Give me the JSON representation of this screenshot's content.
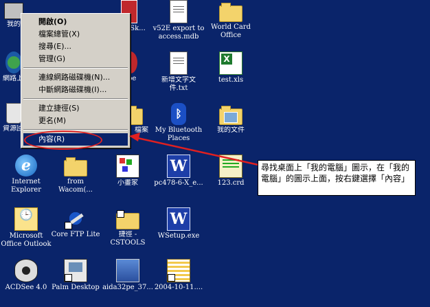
{
  "desktop_icons": [
    {
      "key": "mycomp",
      "label": "我的",
      "icon": "computer-icon"
    },
    {
      "key": "net",
      "label": "網路上",
      "icon": "network-icon"
    },
    {
      "key": "recycle",
      "label": "資源回",
      "icon": "recycle-bin-icon"
    },
    {
      "key": "ie",
      "label": "Internet\nExplorer",
      "icon": "internet-explorer-icon"
    },
    {
      "key": "outlook",
      "label": "Microsoft\nOffice Outlook",
      "icon": "outlook-icon"
    },
    {
      "key": "acdsee",
      "label": "ACDSee 4.0",
      "icon": "acdsee-icon"
    },
    {
      "key": "wacom",
      "label": "from\nWacom(...",
      "icon": "folder-icon"
    },
    {
      "key": "ftp",
      "label": "Core FTP Lite",
      "icon": "ftp-icon"
    },
    {
      "key": "palm",
      "label": "Palm Desktop",
      "icon": "palm-icon"
    },
    {
      "key": "sk",
      "label": "e-Sk...",
      "icon": "app-icon"
    },
    {
      "key": "pe",
      "label": "pe",
      "icon": "app-icon"
    },
    {
      "key": "docfolder",
      "label": "檔案",
      "icon": "folder-icon"
    },
    {
      "key": "paint",
      "label": "小畫家",
      "icon": "paint-icon"
    },
    {
      "key": "cstools",
      "label": "捷徑 -\nCSTOOLS",
      "icon": "shortcut-folder-icon"
    },
    {
      "key": "aida",
      "label": "aida32pe_37...",
      "icon": "aida-icon"
    },
    {
      "key": "v52e",
      "label": "v52E export to\naccess.mdb",
      "icon": "database-icon"
    },
    {
      "key": "newtxt",
      "label": "新增文字文\n件.txt",
      "icon": "text-document-icon"
    },
    {
      "key": "bt",
      "label": "My Bluetooth\nPlaces",
      "icon": "bluetooth-icon"
    },
    {
      "key": "pc478",
      "label": "pc478-6-X_e...",
      "icon": "word-document-icon"
    },
    {
      "key": "wsetup",
      "label": "WSetup.exe",
      "icon": "word-document-icon"
    },
    {
      "key": "d20041011",
      "label": "2004-10-11....",
      "icon": "archive-icon"
    },
    {
      "key": "worldcard",
      "label": "World Card\nOffice",
      "icon": "folder-icon"
    },
    {
      "key": "testxls",
      "label": "test.xls",
      "icon": "excel-icon"
    },
    {
      "key": "mydocs",
      "label": "我的文件",
      "icon": "my-documents-icon"
    },
    {
      "key": "crd",
      "label": "123.crd",
      "icon": "crd-icon"
    }
  ],
  "context_menu": {
    "items": [
      {
        "label": "開啟(O)",
        "bold": true
      },
      {
        "label": "檔案總管(X)"
      },
      {
        "label": "搜尋(E)..."
      },
      {
        "label": "管理(G)"
      },
      {
        "label": "連線網路磁碟機(N)..."
      },
      {
        "label": "中斷網路磁碟機(I)..."
      },
      {
        "label": "建立捷徑(S)"
      },
      {
        "label": "更名(M)"
      },
      {
        "label": "內容(R)",
        "selected": true
      }
    ]
  },
  "annotation": {
    "text": "尋找桌面上「我的電腦」圖示，在「我的電腦」的圖示上面，按右鍵選擇「內容」",
    "color": "#e02020"
  },
  "colors": {
    "desktop_background": "#0a246a",
    "menu_background": "#d4d0c8",
    "menu_highlight": "#0a246a"
  }
}
